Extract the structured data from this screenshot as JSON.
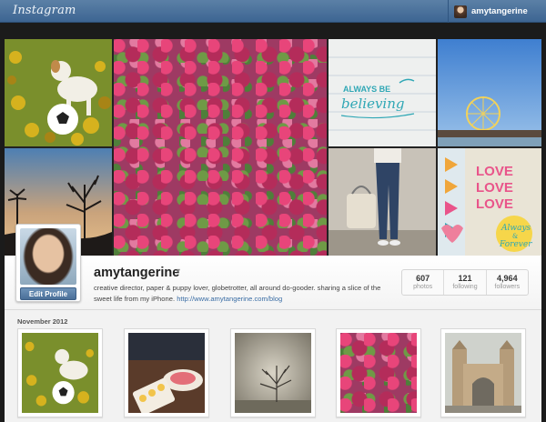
{
  "app": {
    "logo_text": "Instagram"
  },
  "topbar": {
    "username": "amytangerine"
  },
  "profile": {
    "username": "amytangerine",
    "edit_label": "Edit Profile",
    "bio_text": "creative director, paper & puppy lover, globetrotter, all around do-gooder. sharing a slice of the sweet life from my iPhone.",
    "bio_link": "http://www.amytangerine.com/blog",
    "stats": [
      {
        "value": "607",
        "label": "photos"
      },
      {
        "value": "121",
        "label": "following"
      },
      {
        "value": "4,964",
        "label": "followers"
      }
    ]
  },
  "feed": {
    "month_label": "November 2012"
  },
  "mosaic_text": {
    "believing_1": "ALWAYS BE",
    "believing_2": "believing",
    "love_1": "LOVE",
    "love_2": "LOVE",
    "love_3": "LOVE",
    "forever_1": "Always",
    "forever_2": "&",
    "forever_3": "Forever"
  },
  "colors": {
    "topbar": "#3d6592",
    "link": "#3b6ea5",
    "accent_teal": "#2fa7b5"
  }
}
